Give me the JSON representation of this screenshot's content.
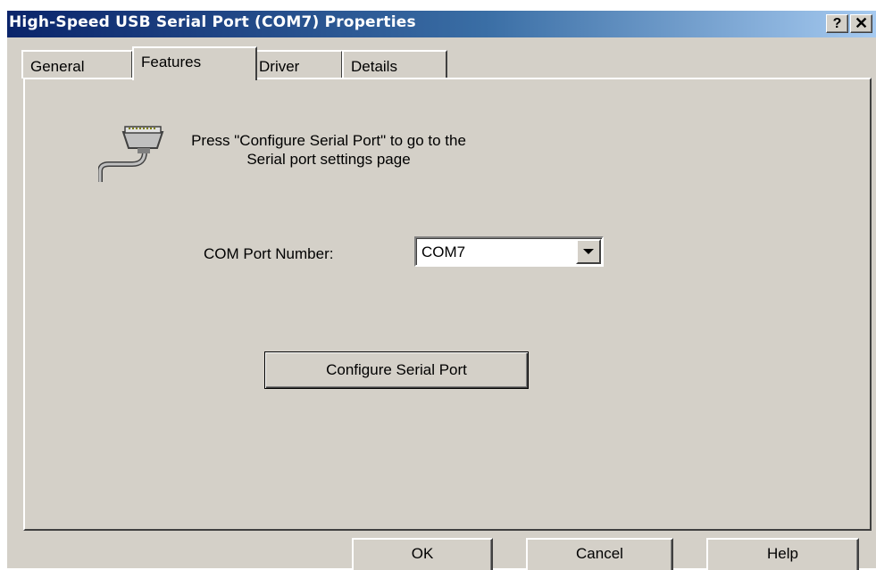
{
  "window": {
    "title": "High-Speed USB Serial Port (COM7) Properties",
    "help_button": "?",
    "close_button": "✕"
  },
  "tabs": [
    {
      "label": "General",
      "selected": false
    },
    {
      "label": "Features",
      "selected": true
    },
    {
      "label": "Driver",
      "selected": false
    },
    {
      "label": "Details",
      "selected": false
    }
  ],
  "features": {
    "icon": "serial-port-icon",
    "instructions_line1": "Press \"Configure Serial Port\" to go to the",
    "instructions_line2": "Serial port settings page",
    "com_port_label": "COM Port Number:",
    "com_port_value": "COM7",
    "configure_button": "Configure Serial Port"
  },
  "buttons": {
    "ok": "OK",
    "cancel": "Cancel",
    "help": "Help"
  },
  "colors": {
    "face": "#d4d0c8",
    "title_start": "#0a246a",
    "title_end": "#a6caf0"
  }
}
